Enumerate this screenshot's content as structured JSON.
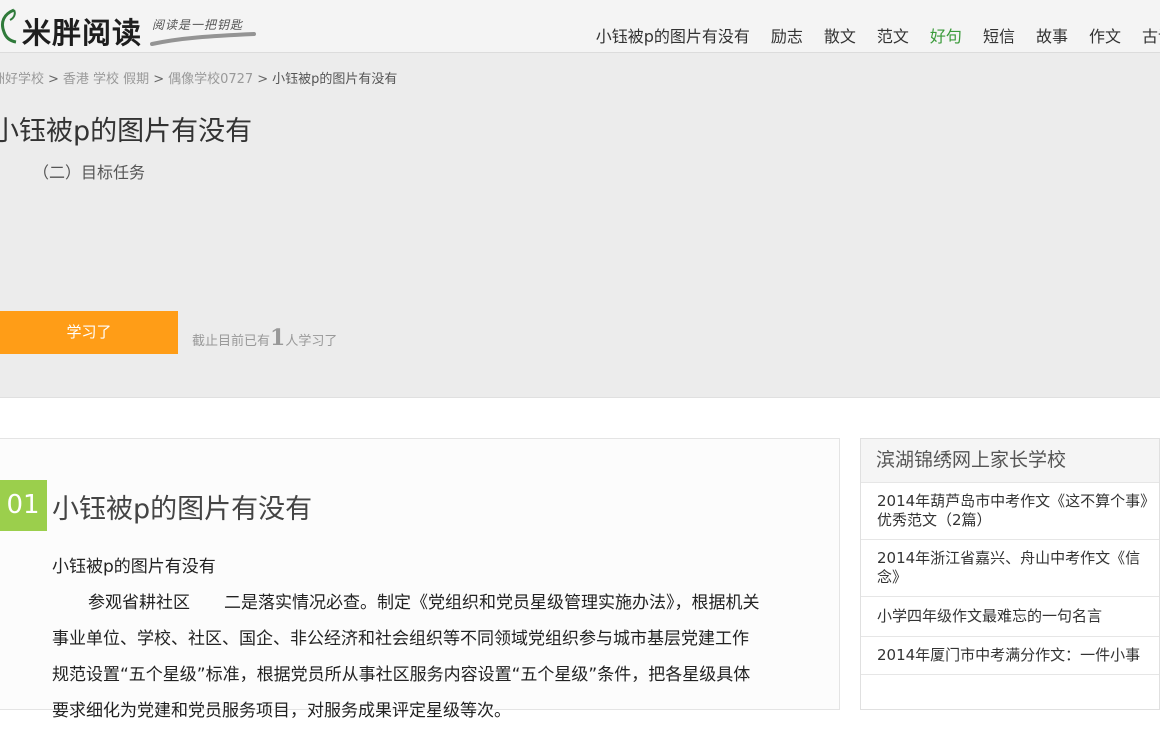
{
  "header": {
    "logo_text": "米胖阅读",
    "slogan": "阅读是一把钥匙",
    "nav": [
      {
        "label": "小钰被p的图片有没有",
        "active": false
      },
      {
        "label": "励志",
        "active": false
      },
      {
        "label": "散文",
        "active": false
      },
      {
        "label": "范文",
        "active": false
      },
      {
        "label": "好句",
        "active": true
      },
      {
        "label": "短信",
        "active": false
      },
      {
        "label": "故事",
        "active": false
      },
      {
        "label": "作文",
        "active": false
      },
      {
        "label": "古诗",
        "active": false
      }
    ]
  },
  "breadcrumb": [
    "洲好学校",
    "香港 学校 假期",
    "偶像学校0727",
    "小钰被p的图片有没有"
  ],
  "breadcrumb_sep": ">",
  "hero": {
    "title": "小钰被p的图片有没有",
    "subline": "（二）目标任务",
    "learn_button": "学习了",
    "count_prefix": "截止目前已有",
    "count": "1",
    "count_suffix": "人学习了"
  },
  "article": {
    "section_number": "01",
    "section_title": "小钰被p的图片有没有",
    "subtitle": "小钰被p的图片有没有",
    "paragraph": "参观省耕社区　　二是落实情况必查。制定《党组织和党员星级管理实施办法》，根据机关事业单位、学校、社区、国企、非公经济和社会组织等不同领域党组织参与城市基层党建工作规范设置“五个星级”标准，根据党员所从事社区服务内容设置“五个星级”条件，把各星级具体要求细化为党建和党员服务项目，对服务成果评定星级等次。"
  },
  "sidebar": {
    "title": "滨湖锦绣网上家长学校",
    "items": [
      "2014年葫芦岛市中考作文《这不算个事》优秀范文（2篇）",
      "2014年浙江省嘉兴、舟山中考作文《信念》",
      "小学四年级作文最难忘的一句名言",
      "2014年厦门市中考满分作文：一件小事"
    ]
  },
  "colors": {
    "accent_orange": "#ff9d17",
    "accent_green": "#9bcf4c",
    "nav_active": "#3a9a3a"
  }
}
